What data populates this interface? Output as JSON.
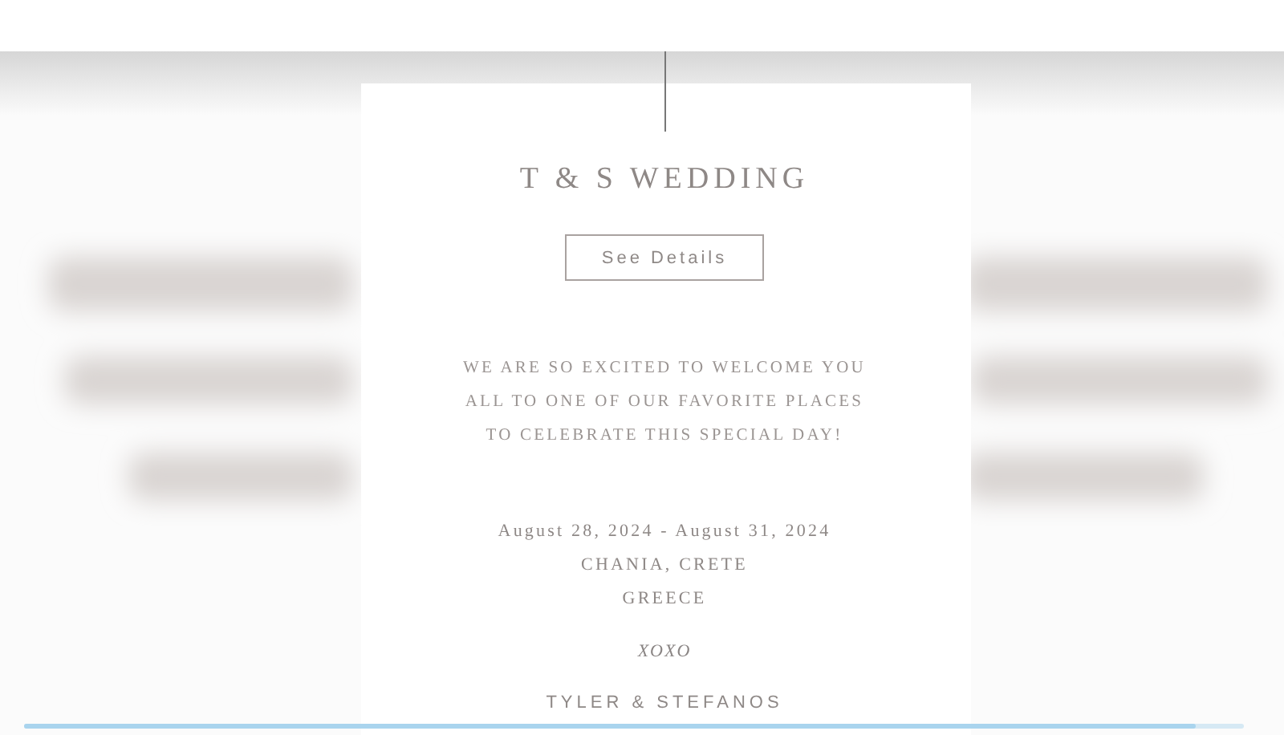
{
  "title": "T & S WEDDING",
  "button": "See Details",
  "welcome": [
    "WE ARE SO EXCITED TO WELCOME YOU",
    "ALL TO ONE OF OUR FAVORITE PLACES",
    "TO CELEBRATE THIS SPECIAL DAY!"
  ],
  "details": [
    "August 28, 2024 - August 31, 2024",
    "CHANIA, CRETE",
    "GREECE"
  ],
  "signoff": "XOXO",
  "names": "TYLER & STEFANOS",
  "video_progress": {
    "level": 0.96
  }
}
